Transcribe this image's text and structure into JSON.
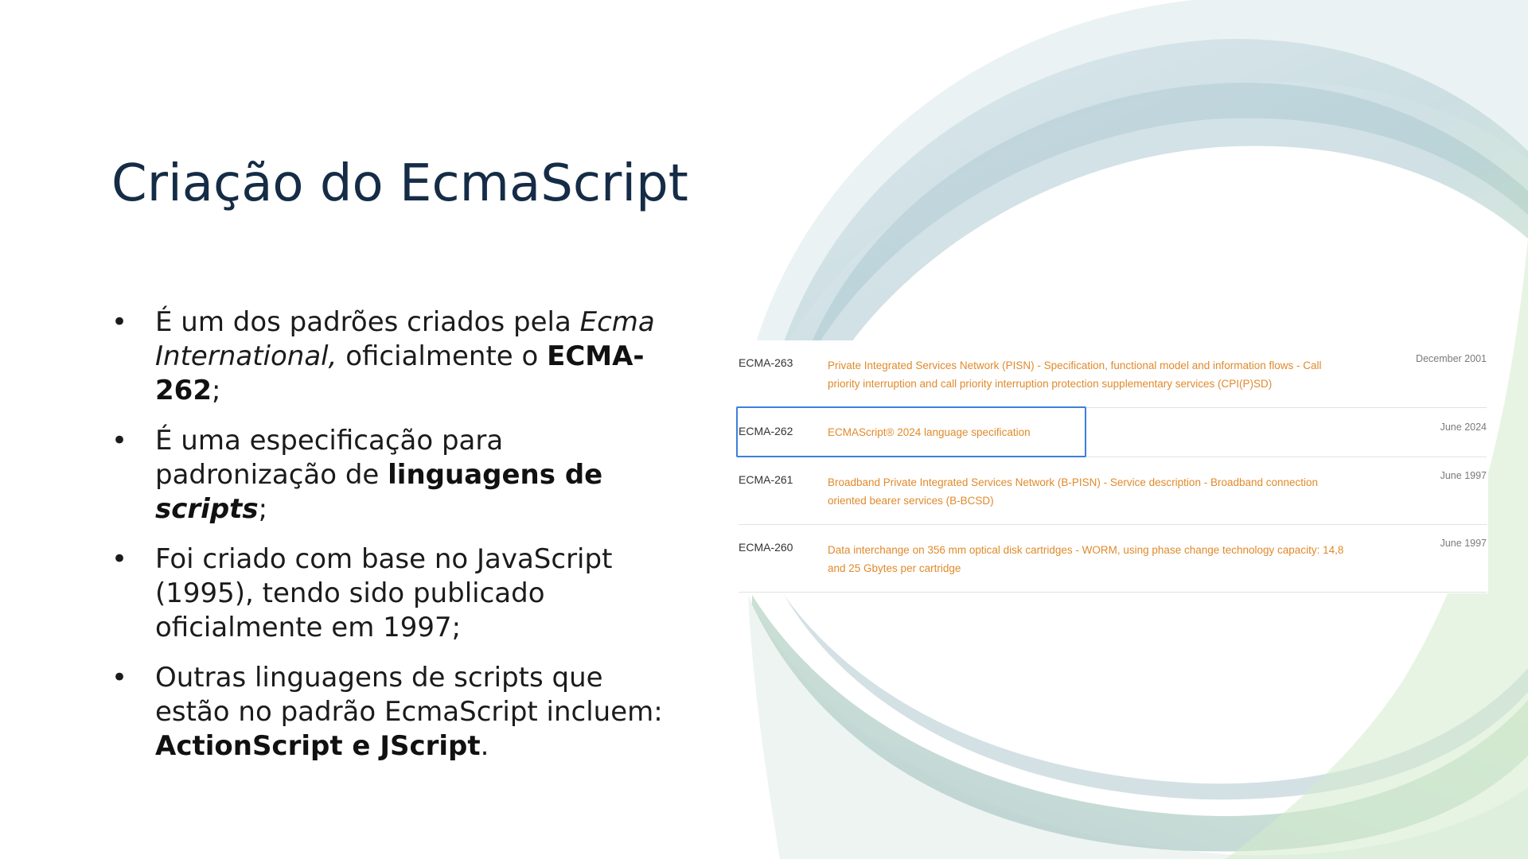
{
  "title": "Criação do EcmaScript",
  "bullet_glyph": "•",
  "bullets": [
    {
      "t1": "É um dos padrões criados pela ",
      "t2": "Ecma International,",
      "t3": " oficialmente o ",
      "t4": "ECMA-262",
      "t5": ";"
    },
    {
      "t1": "É uma especificação para padronização de ",
      "t2": "linguagens de ",
      "t3": "scripts",
      "t4": ";"
    },
    {
      "t1": "Foi criado com base no JavaScript (1995), tendo sido publicado oficialmente em 1997;"
    },
    {
      "t1": "Outras linguagens de scripts que estão no padrão EcmaScript incluem: ",
      "t2": "ActionScript e JScript",
      "t3": "."
    }
  ],
  "screenshot": {
    "rows": [
      {
        "code": "ECMA-263",
        "desc": "Private Integrated Services Network (PISN) - Specification, functional model and information flows - Call priority interruption and call priority interruption protection supplementary services (CPI(P)SD)",
        "date": "December 2001"
      },
      {
        "code": "ECMA-262",
        "desc": "ECMAScript® 2024 language specification",
        "date": "June 2024"
      },
      {
        "code": "ECMA-261",
        "desc": "Broadband Private Integrated Services Network (B-PISN) - Service description - Broadband connection oriented bearer services (B-BCSD)",
        "date": "June 1997"
      },
      {
        "code": "ECMA-260",
        "desc": "Data interchange on 356 mm optical disk cartridges - WORM, using phase change technology capacity: 14,8 and 25 Gbytes per cartridge",
        "date": "June 1997"
      }
    ]
  },
  "colors": {
    "title": "#152c46",
    "link_orange": "#e08a2c",
    "highlight_blue": "#3c7fdf",
    "decor_blue": "#b7cfd8",
    "decor_green": "#cfe8c9"
  }
}
